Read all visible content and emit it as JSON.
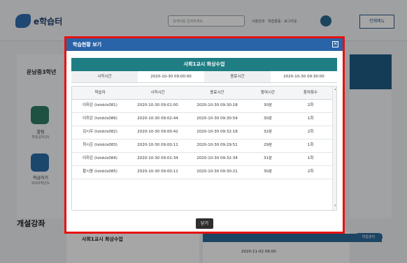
{
  "app": {
    "logo_text": "e학습터",
    "search_placeholder": "검색어를 입력하세요",
    "top_menu": "사용안내 · 학습활동 · 로그아웃",
    "all_menu_label": "전체메뉴",
    "school_name": "운남중3학년",
    "left_buttons": [
      {
        "label": "알림",
        "sub": "학습공지(0)"
      },
      {
        "label": "학급하기",
        "sub": "2020학년도"
      }
    ],
    "class_section_title": "개설강좌",
    "lower_card_title": "사회1교시 화상수업",
    "lower_card_date": "2020-11-02 09:00",
    "right_button": "학습관리"
  },
  "modal": {
    "title": "학습현황 보기",
    "close_glyph": "✕",
    "lesson_title": "사회1교시 화상수업",
    "time_row": {
      "start_label": "시작시간",
      "start_value": "2020-10-30 09:00:00",
      "end_label": "종료시간",
      "end_value": "2020-10-30 09:30:00"
    },
    "table": {
      "headers": [
        "학습자",
        "시작시간",
        "종료시간",
        "참여시간",
        "참여횟수"
      ],
      "rows": [
        [
          "이하은 (tstdcls081)",
          "2020-10-30 09:01:00",
          "2020-10-30 09:30:18",
          "30분",
          "2회"
        ],
        [
          "이하은 (tstdcls086)",
          "2020-10-30 09:02:44",
          "2020-10-30 09:30:59",
          "30분",
          "1회"
        ],
        [
          "김시우 (tstdcls082)",
          "2020-10-30 09:00:42",
          "2020-10-30 09:32:18",
          "32분",
          "2회"
        ],
        [
          "최시은 (tstdcls083)",
          "2020-10-30 09:00:11",
          "2020-10-30 09:29:51",
          "29분",
          "1회"
        ],
        [
          "이하은 (tstdcls084)",
          "2020-10-30 09:01:34",
          "2020-10-30 09:32:34",
          "31분",
          "1회"
        ],
        [
          "황시윤 (tstdcls085)",
          "2020-10-30 09:00:11",
          "2020-10-30 09:30:21",
          "30분",
          "2회"
        ]
      ]
    },
    "close_button": "닫기"
  }
}
